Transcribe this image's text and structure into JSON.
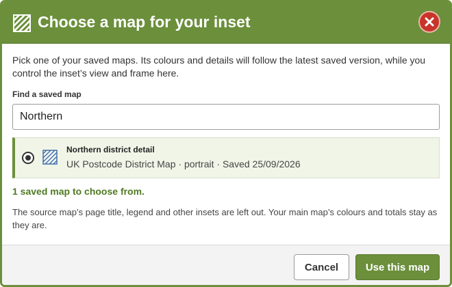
{
  "dialog": {
    "title": "Choose a map for your inset",
    "title_icon": "map-hatch-icon",
    "close_icon": "close-icon"
  },
  "intro": "Pick one of your saved maps. Its colours and details will follow the latest saved version, while you control the inset’s view and frame here.",
  "search": {
    "label": "Find a saved map",
    "value": "Northern"
  },
  "results": [
    {
      "name": "Northern district detail",
      "meta": "UK Postcode District Map · portrait · Saved 25/09/2026",
      "selected": true,
      "icon": "map-hatch-icon"
    }
  ],
  "results_count": "1 saved map to choose from.",
  "note": "The source map’s page title, legend and other insets are left out. Your main map’s colours and totals stay as they are.",
  "footer": {
    "cancel_label": "Cancel",
    "confirm_label": "Use this map"
  },
  "colors": {
    "accent": "#6b8f3b",
    "close": "#c9342a",
    "count_text": "#4f7a22"
  }
}
